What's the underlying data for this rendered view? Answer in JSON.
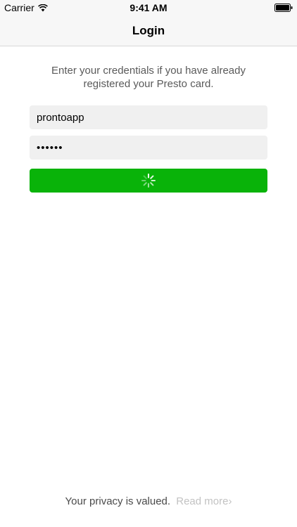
{
  "status_bar": {
    "carrier": "Carrier",
    "time": "9:41 AM",
    "wifi_icon": "wifi-icon",
    "battery_icon": "battery-icon"
  },
  "nav": {
    "title": "Login"
  },
  "intro_text": "Enter your credentials if you have already registered your Presto card.",
  "form": {
    "username_value": "prontoapp",
    "password_value": "••••••",
    "login_button_icon": "spinner-icon"
  },
  "footer": {
    "privacy_text": "Your privacy is valued.",
    "read_more_label": "Read more›"
  },
  "colors": {
    "accent_green": "#09b309",
    "field_background": "#f0f0f0",
    "bar_background": "#f7f7f7",
    "link_gray": "#c2c2c2"
  }
}
